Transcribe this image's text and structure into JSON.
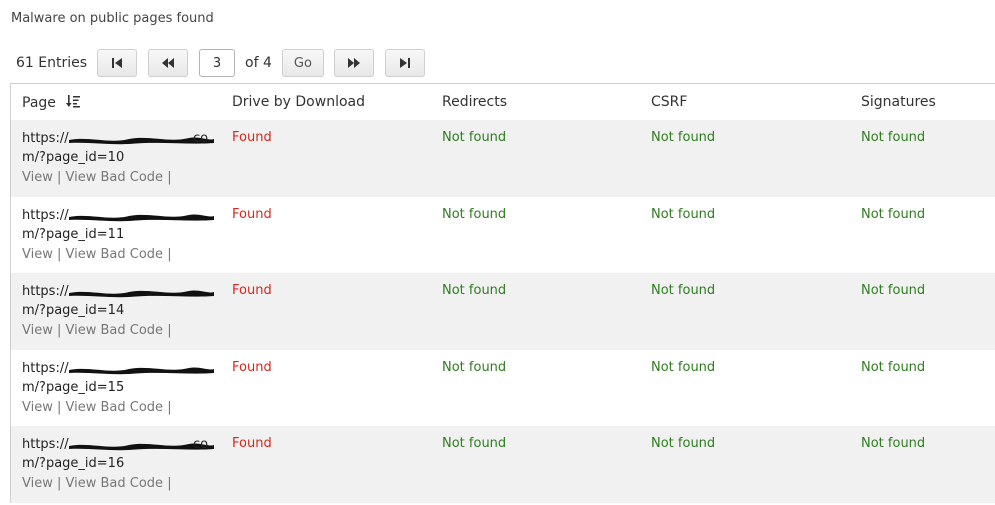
{
  "title": "Malware on public pages found",
  "pager": {
    "entries": "61 Entries",
    "first_icon": "first-page-icon",
    "prev_icon": "previous-page-icon",
    "current_page": "3",
    "of_pages": "of 4",
    "go_label": "Go",
    "next_icon": "next-page-icon",
    "last_icon": "last-page-icon"
  },
  "table": {
    "columns": [
      "Page",
      "Drive by Download",
      "Redirects",
      "CSRF",
      "Signatures"
    ],
    "sort_icon": "sort-descending-icon",
    "view_label": "View",
    "bad_code_label": "View Bad Code",
    "rows": [
      {
        "url_line1": "https://",
        "url_tail": "co",
        "url_line2": "m/?page_id=10",
        "drive": "Found",
        "redirects": "Not found",
        "csrf": "Not found",
        "signatures": "Not found"
      },
      {
        "url_line1": "https://",
        "url_tail": "",
        "url_line2": "m/?page_id=11",
        "drive": "Found",
        "redirects": "Not found",
        "csrf": "Not found",
        "signatures": "Not found"
      },
      {
        "url_line1": "https://",
        "url_tail": "",
        "url_line2": "m/?page_id=14",
        "drive": "Found",
        "redirects": "Not found",
        "csrf": "Not found",
        "signatures": "Not found"
      },
      {
        "url_line1": "https://",
        "url_tail": "",
        "url_line2": "m/?page_id=15",
        "drive": "Found",
        "redirects": "Not found",
        "csrf": "Not found",
        "signatures": "Not found"
      },
      {
        "url_line1": "https://",
        "url_tail": "co",
        "url_line2": "m/?page_id=16",
        "drive": "Found",
        "redirects": "Not found",
        "csrf": "Not found",
        "signatures": "Not found"
      }
    ]
  },
  "colors": {
    "found": "#d9261c",
    "not_found": "#2e7d1f",
    "row_alt": "#f1f1f1"
  }
}
